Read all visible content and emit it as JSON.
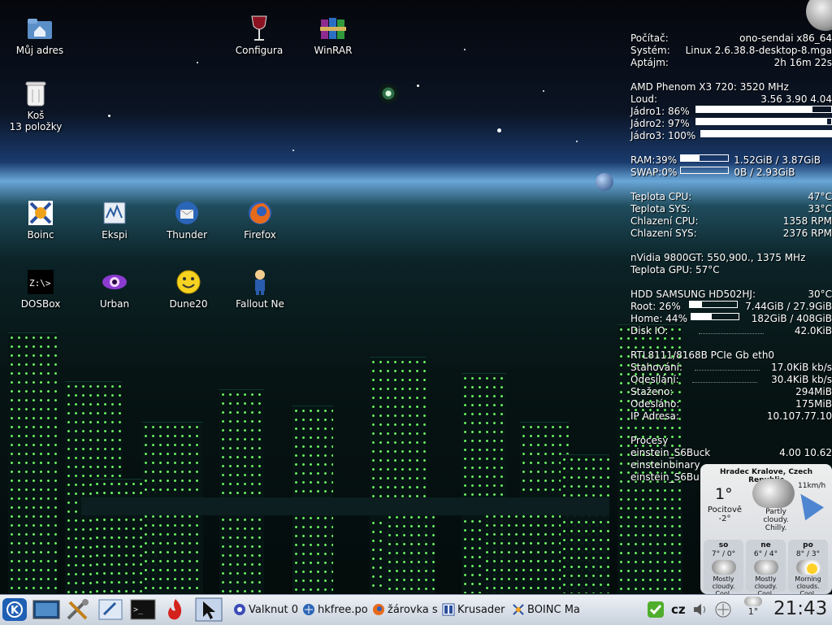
{
  "desktop_icons": [
    {
      "label": "Můj adres",
      "icon": "home-folder-icon"
    },
    {
      "label": "Configura",
      "icon": "wine-glass-icon"
    },
    {
      "label": "WinRAR",
      "icon": "winrar-books-icon"
    },
    {
      "label": "Koš",
      "sub": "13 položky",
      "icon": "trash-icon"
    },
    {
      "label": "Boinc",
      "icon": "boinc-icon"
    },
    {
      "label": "Ekspi",
      "icon": "ekspi-icon"
    },
    {
      "label": "Thunder",
      "icon": "thunderbird-icon"
    },
    {
      "label": "Firefox",
      "icon": "firefox-icon"
    },
    {
      "label": "DOSBox",
      "icon": "dosbox-icon"
    },
    {
      "label": "Urban",
      "icon": "urban-eye-icon"
    },
    {
      "label": "Dune20",
      "icon": "smiley-icon"
    },
    {
      "label": "Fallout Ne",
      "icon": "fallout-vaultboy-icon"
    }
  ],
  "conky": {
    "pocitac_l": "Počítač:",
    "pocitac_v": "ono-sendai x86_64",
    "system_l": "Systém:",
    "system_v": "Linux 2.6.38.8-desktop-8.mga",
    "aptajm_l": "Aptájm:",
    "aptajm_v": "2h 16m 22s",
    "cpu_name": "AMD Phenom X3 720: 3520 MHz",
    "loud_l": "Loud:",
    "loud_v": "3.56 3.90 4.04",
    "cores": [
      {
        "label": "Jádro1: 86%",
        "value": 0.86
      },
      {
        "label": "Jádro2: 97%",
        "value": 0.97
      },
      {
        "label": "Jádro3: 100%",
        "value": 1.0
      }
    ],
    "ram_l": "RAM:39%",
    "ram_v": "1.52GiB / 3.87GiB",
    "ram_frac": 0.39,
    "swap_l": "SWAP:0%",
    "swap_v": "0B / 2.93GiB",
    "swap_frac": 0.0,
    "temp_cpu_l": "Teplota CPU:",
    "temp_cpu_v": "47°C",
    "temp_sys_l": "Teplota SYS:",
    "temp_sys_v": "33°C",
    "fan_cpu_l": "Chlazení CPU:",
    "fan_cpu_v": "1358 RPM",
    "fan_sys_l": "Chlazení SYS:",
    "fan_sys_v": "2376 RPM",
    "gpu_name": "nVidia 9800GT: 550,900., 1375 MHz",
    "gpu_temp": "Teplota GPU:  57°C",
    "hdd_l": "HDD SAMSUNG HD502HJ:",
    "hdd_v": "30°C",
    "root_l": "Root: 26%",
    "root_v": "7.44GiB / 27.9GiB",
    "root_frac": 0.26,
    "home_l": "Home: 44%",
    "home_v": "182GiB / 408GiB",
    "home_frac": 0.44,
    "diskio_l": "Disk IO:",
    "diskio_v": "42.0KiB",
    "net_name": "RTL8111/8168B PCIe Gb eth0",
    "down_l": "Stahování:",
    "down_v": "17.0KiB kb/s",
    "up_l": "Odesílání:",
    "up_v": "30.4KiB kb/s",
    "downloaded_l": "Staženo:",
    "downloaded_v": "294MiB",
    "uploaded_l": "Odesláno:",
    "uploaded_v": "175MiB",
    "ip_l": "IP Adresa:",
    "ip_v": "10.107.77.10",
    "proc_l": "Procesy",
    "procs": [
      {
        "name": "einstein_S6Buck",
        "v": "4.00  10.62"
      },
      {
        "name": "einsteinbinary",
        "v": ""
      },
      {
        "name": "einstein_S6Bu",
        "v": ""
      }
    ]
  },
  "weather": {
    "location": "Hradec Kralove, Czech Republic",
    "temp": "1°",
    "feels_l": "Pocitově",
    "feels_v": "-2°",
    "wind": "11km/h",
    "desc": "Partly cloudy. Chilly.",
    "forecast": [
      {
        "day": "so",
        "temp": "7° / 0°",
        "desc": "Mostly cloudy. Cool."
      },
      {
        "day": "ne",
        "temp": "6° / 4°",
        "desc": "Mostly cloudy. Cool."
      },
      {
        "day": "po",
        "temp": "8° / 3°",
        "desc": "Morning clouds. Cool."
      }
    ]
  },
  "taskbar": {
    "tasks": [
      {
        "label": "Valknut 0",
        "icon": "valknut-icon"
      },
      {
        "label": "hkfree.po",
        "icon": "konqueror-icon"
      },
      {
        "label": "žárovka s",
        "icon": "firefox-icon"
      },
      {
        "label": "Krusader",
        "icon": "krusader-icon"
      },
      {
        "label": "BOINC Ma",
        "icon": "boinc-icon"
      }
    ],
    "keyboard_layout": "cz",
    "tray_temp": "1°",
    "clock": "21:43"
  }
}
